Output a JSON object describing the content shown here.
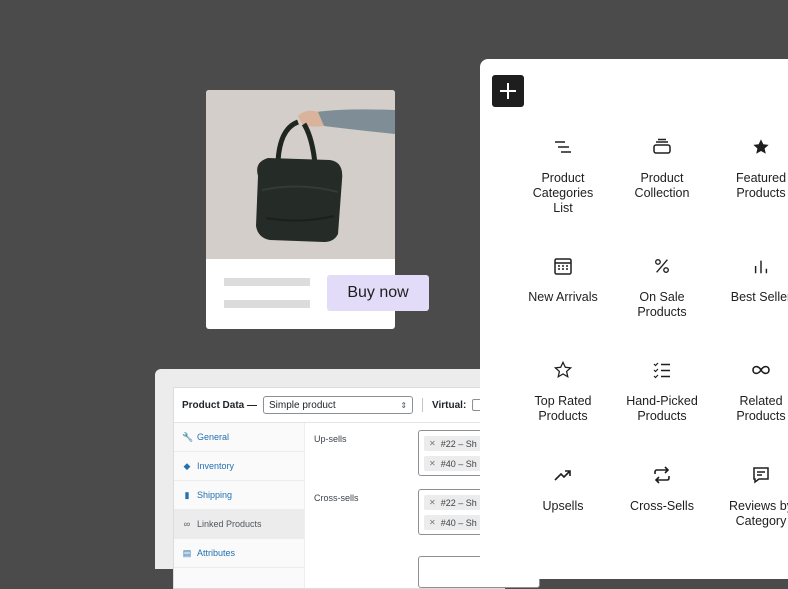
{
  "product_card": {
    "image_alt": "Black duffel bag held by hand",
    "buy_label": "Buy now",
    "button_color": "#e3dcf9"
  },
  "product_data": {
    "title": "Product Data —",
    "product_type": "Simple product",
    "virtual_label": "Virtual:",
    "tabs": [
      {
        "label": "General",
        "icon": "wrench-icon"
      },
      {
        "label": "Inventory",
        "icon": "tag-icon"
      },
      {
        "label": "Shipping",
        "icon": "truck-icon"
      },
      {
        "label": "Linked Products",
        "icon": "link-icon",
        "active": true
      },
      {
        "label": "Attributes",
        "icon": "list-icon"
      }
    ],
    "upsells_label": "Up-sells",
    "upsells": [
      "#22 – Sh",
      "#40 – Sh"
    ],
    "crosssells_label": "Cross-sells",
    "crosssells": [
      "#22 – Sh",
      "#40 – Sh"
    ]
  },
  "inserter": {
    "blocks": [
      {
        "label": "Product\nCategories\nList",
        "icon": "categories-list-icon"
      },
      {
        "label": "Product\nCollection",
        "icon": "collection-icon"
      },
      {
        "label": "Featured\nProducts",
        "icon": "star-filled-icon"
      },
      {
        "label": "New Arrivals",
        "icon": "calendar-icon"
      },
      {
        "label": "On Sale\nProducts",
        "icon": "percent-icon"
      },
      {
        "label": "Best Seller",
        "icon": "bar-chart-icon"
      },
      {
        "label": "Top Rated\nProducts",
        "icon": "star-outline-icon"
      },
      {
        "label": "Hand-Picked\nProducts",
        "icon": "checklist-icon"
      },
      {
        "label": "Related\nProducts",
        "icon": "infinity-icon"
      },
      {
        "label": "Upsells",
        "icon": "trend-up-icon"
      },
      {
        "label": "Cross-Sells",
        "icon": "repeat-icon"
      },
      {
        "label": "Reviews by\nCategory",
        "icon": "comment-icon"
      }
    ]
  }
}
